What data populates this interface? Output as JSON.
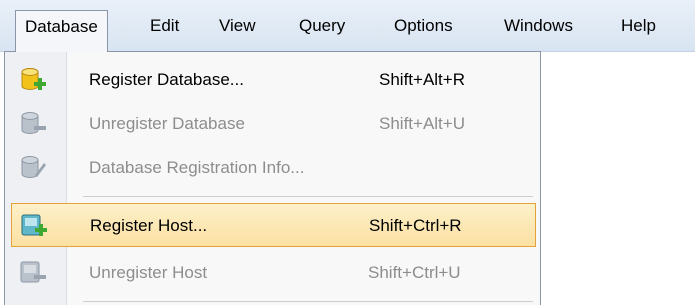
{
  "menubar": {
    "items": [
      {
        "label": "Database"
      },
      {
        "label": "Edit"
      },
      {
        "label": "View"
      },
      {
        "label": "Query"
      },
      {
        "label": "Options"
      },
      {
        "label": "Windows"
      },
      {
        "label": "Help"
      }
    ]
  },
  "dropdown": {
    "items": [
      {
        "label": "Register Database...",
        "shortcut": "Shift+Alt+R",
        "enabled": true,
        "icon": "database-add-icon"
      },
      {
        "label": "Unregister Database",
        "shortcut": "Shift+Alt+U",
        "enabled": false,
        "icon": "database-remove-icon"
      },
      {
        "label": "Database Registration Info...",
        "shortcut": "",
        "enabled": false,
        "icon": "database-info-icon"
      },
      {
        "label": "Register Host...",
        "shortcut": "Shift+Ctrl+R",
        "enabled": true,
        "highlighted": true,
        "icon": "host-add-icon"
      },
      {
        "label": "Unregister Host",
        "shortcut": "Shift+Ctrl+U",
        "enabled": false,
        "icon": "host-remove-icon"
      }
    ]
  },
  "colors": {
    "highlight_bg": "#fbe3a6",
    "highlight_border": "#e3a23a",
    "disabled_text": "#8d8d8d",
    "icon_yellow": "#f2c21b",
    "icon_green": "#3ea832",
    "icon_gray": "#a9b3bf",
    "icon_teal": "#3a9a9a"
  }
}
